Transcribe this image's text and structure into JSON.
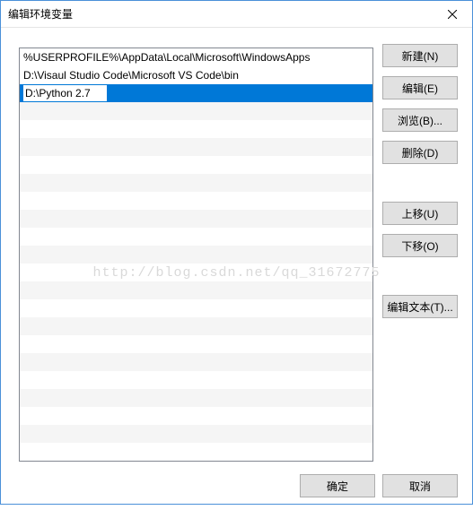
{
  "title": "编辑环境变量",
  "list": {
    "items": [
      "%USERPROFILE%\\AppData\\Local\\Microsoft\\WindowsApps",
      "D:\\Visaul Studio Code\\Microsoft VS Code\\bin"
    ],
    "editing_value": "D:\\Python 2.7"
  },
  "buttons": {
    "new": "新建(N)",
    "edit": "编辑(E)",
    "browse": "浏览(B)...",
    "delete": "删除(D)",
    "move_up": "上移(U)",
    "move_down": "下移(O)",
    "edit_text": "编辑文本(T)...",
    "ok": "确定",
    "cancel": "取消"
  },
  "watermark": "http://blog.csdn.net/qq_31672775"
}
